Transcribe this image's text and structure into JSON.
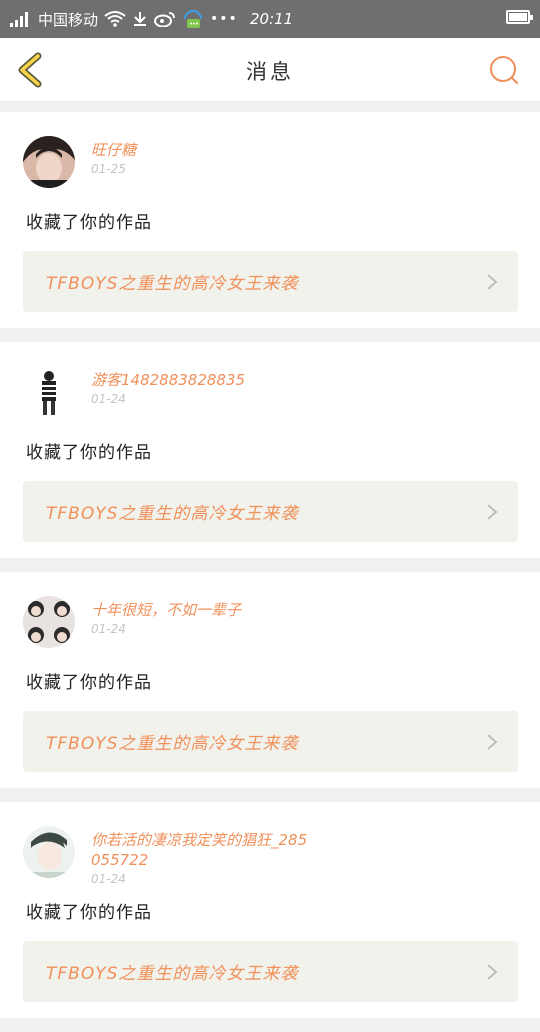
{
  "status_bar": {
    "carrier": "中国移动",
    "time": "20:11",
    "battery_level": 1.0,
    "icons": [
      "signal-icon",
      "wifi-icon",
      "download-icon",
      "weibo-icon",
      "chat-icon",
      "more-dots-icon",
      "battery-icon"
    ]
  },
  "header": {
    "title": "消息",
    "back_icon": "back-chevron-icon",
    "search_icon": "search-icon"
  },
  "colors": {
    "accent": "#f0905a",
    "back_icon_stroke": "#5a5a3a",
    "back_icon_fill": "#f7d24a",
    "work_bg": "#f2f2ec",
    "page_bg": "#f1f1f1"
  },
  "messages": [
    {
      "user": "旺仔糖",
      "date": "01-25",
      "action": "收藏了你的作品",
      "work_title": "TFBOYS之重生的高冷女王来袭",
      "avatar_style": "dark"
    },
    {
      "user": "游客1482883828835",
      "date": "01-24",
      "action": "收藏了你的作品",
      "work_title": "TFBOYS之重生的高冷女王来袭",
      "avatar_style": "figure"
    },
    {
      "user": "十年很短，不如一辈子",
      "date": "01-24",
      "action": "收藏了你的作品",
      "work_title": "TFBOYS之重生的高冷女王来袭",
      "avatar_style": "grid"
    },
    {
      "user": "你若活的凄凉我定笑的猖狂_285055722",
      "date": "01-24",
      "action": "收藏了你的作品",
      "work_title": "TFBOYS之重生的高冷女王来袭",
      "avatar_style": "light"
    }
  ]
}
